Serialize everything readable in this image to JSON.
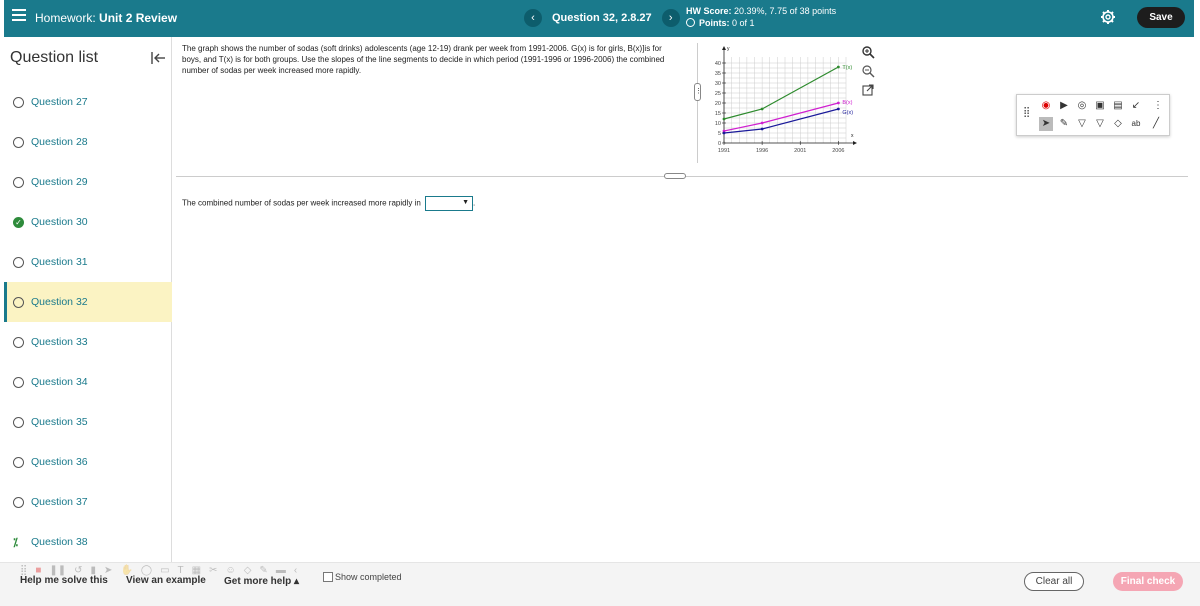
{
  "header": {
    "homework_label": "Homework:",
    "homework_title": "Unit 2 Review",
    "question_nav": "Question 32, 2.8.27",
    "hw_score_label": "HW Score:",
    "hw_score_value": "20.39%, 7.75 of 38 points",
    "points_label": "Points:",
    "points_value": "0 of 1",
    "save_label": "Save"
  },
  "sidebar": {
    "title": "Question list",
    "items": [
      {
        "label": "Question 27",
        "status": "unanswered"
      },
      {
        "label": "Question 28",
        "status": "unanswered"
      },
      {
        "label": "Question 29",
        "status": "unanswered"
      },
      {
        "label": "Question 30",
        "status": "correct"
      },
      {
        "label": "Question 31",
        "status": "unanswered"
      },
      {
        "label": "Question 32",
        "status": "current"
      },
      {
        "label": "Question 33",
        "status": "unanswered"
      },
      {
        "label": "Question 34",
        "status": "unanswered"
      },
      {
        "label": "Question 35",
        "status": "unanswered"
      },
      {
        "label": "Question 36",
        "status": "unanswered"
      },
      {
        "label": "Question 37",
        "status": "unanswered"
      },
      {
        "label": "Question 38",
        "status": "partial"
      }
    ]
  },
  "question": {
    "text": "The graph shows the number of sodas (soft drinks) adolescents (age 12-19) drank per week from 1991-2006. G(x) is for girls, B(x)]is for boys, and T(x) is for both groups. Use the slopes of the line segments to decide in which period (1991-1996 or 1996-2006) the combined number of sodas per week increased more rapidly.",
    "answer_prompt": "The combined number of sodas per week increased more rapidly in",
    "answer_suffix": ".",
    "dropdown_value": ""
  },
  "chart_data": {
    "type": "line",
    "x": [
      1991,
      1996,
      2006
    ],
    "xlabel": "x",
    "ylabel": "y",
    "xticks": [
      "1991",
      "1996",
      "2001",
      "2006"
    ],
    "yticks": [
      "0",
      "5",
      "10",
      "15",
      "20",
      "25",
      "30",
      "35",
      "40"
    ],
    "ylim": [
      0,
      40
    ],
    "grid": true,
    "series": [
      {
        "name": "T(x)",
        "values": [
          12,
          17,
          38
        ],
        "color": "#2e8b2e"
      },
      {
        "name": "B(x)",
        "values": [
          6,
          10,
          20
        ],
        "color": "#d020d0"
      },
      {
        "name": "G(x)",
        "values": [
          5,
          7,
          17
        ],
        "color": "#1a1a9a"
      }
    ]
  },
  "bottom": {
    "help_solve": "Help me solve this",
    "view_example": "View an example",
    "more_help": "Get more help ▴",
    "show_completed": "Show completed",
    "clear_all": "Clear all",
    "final_check": "Final check"
  },
  "colors": {
    "header": "#1a7a8c",
    "current_row": "#fbf3c3",
    "final_check": "#f5a6b4"
  }
}
